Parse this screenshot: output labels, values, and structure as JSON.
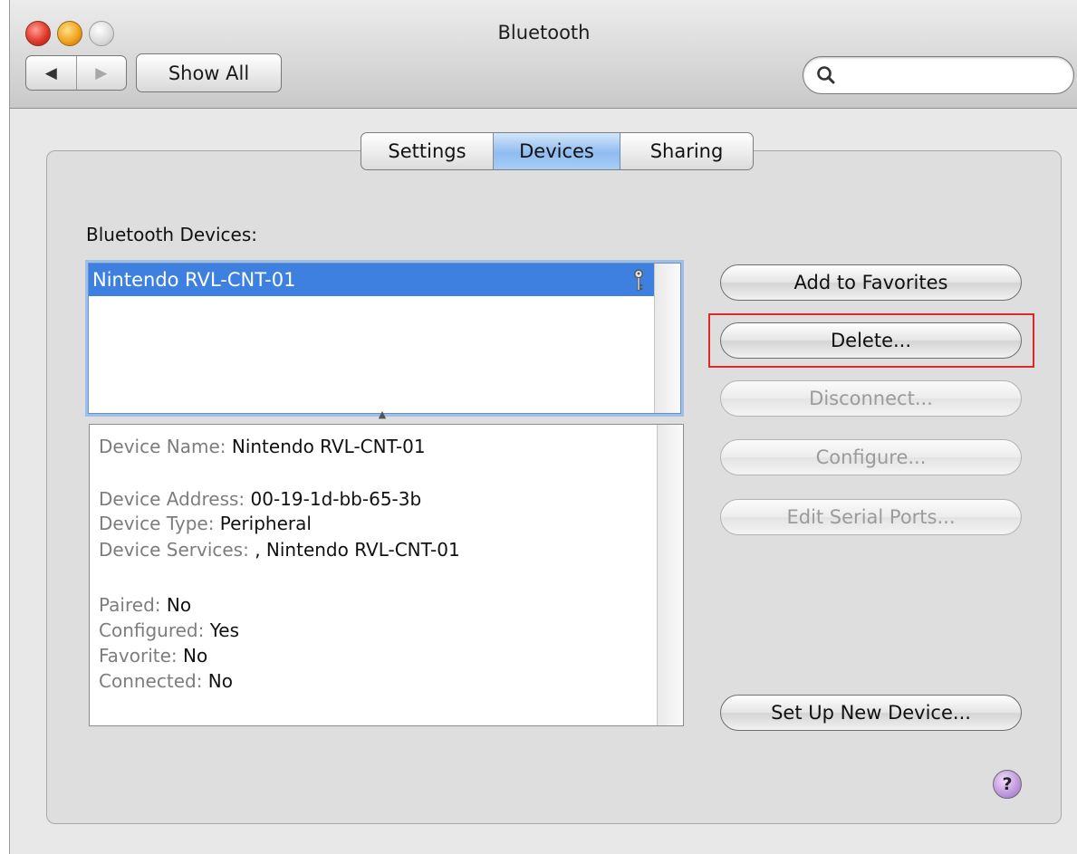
{
  "window": {
    "title": "Bluetooth"
  },
  "toolbar": {
    "back_glyph": "◀",
    "forward_glyph": "▶",
    "show_all_label": "Show All",
    "search_value": "",
    "search_placeholder": ""
  },
  "tabs": [
    {
      "label": "Settings",
      "selected": false
    },
    {
      "label": "Devices",
      "selected": true
    },
    {
      "label": "Sharing",
      "selected": false
    }
  ],
  "devices_section": {
    "label": "Bluetooth Devices:",
    "devices": [
      {
        "name": "Nintendo RVL-CNT-01",
        "selected": true,
        "icon": "key-icon"
      }
    ]
  },
  "details": {
    "device_name": {
      "key": "Device Name:",
      "value": "Nintendo RVL-CNT-01"
    },
    "device_address": {
      "key": "Device Address:",
      "value": "00-19-1d-bb-65-3b"
    },
    "device_type": {
      "key": "Device Type:",
      "value": "Peripheral"
    },
    "device_services": {
      "key": "Device Services:",
      "value": ", Nintendo RVL-CNT-01"
    },
    "paired": {
      "key": "Paired:",
      "value": "No"
    },
    "configured": {
      "key": "Configured:",
      "value": "Yes"
    },
    "favorite": {
      "key": "Favorite:",
      "value": "No"
    },
    "connected": {
      "key": "Connected:",
      "value": "No"
    }
  },
  "buttons": {
    "add_to_favorites": "Add to Favorites",
    "delete": "Delete...",
    "disconnect": "Disconnect...",
    "configure": "Configure...",
    "edit_serial_ports": "Edit Serial Ports...",
    "set_up_new_device": "Set Up New Device...",
    "help": "?"
  },
  "colors": {
    "selection": "#3d80df",
    "highlight_box": "#e0262b",
    "selected_tab": "#8fbcef"
  }
}
